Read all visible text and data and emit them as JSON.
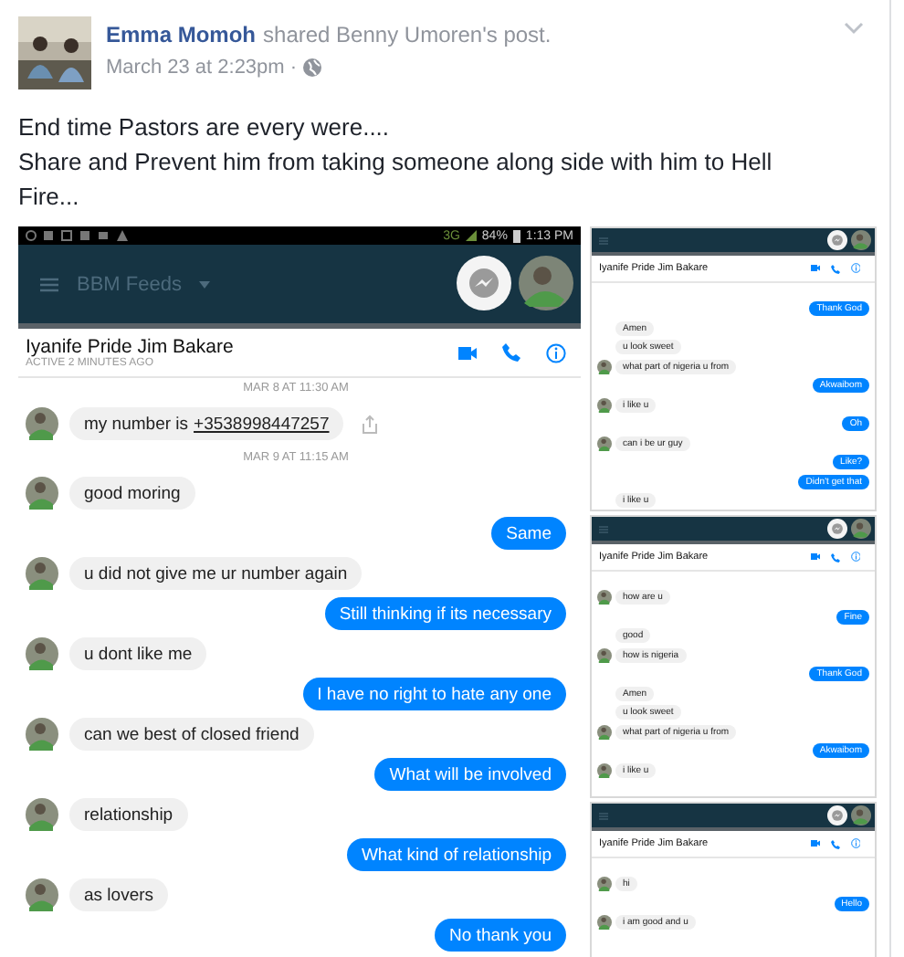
{
  "post": {
    "author": "Emma Momoh",
    "action": "shared Benny Umoren's post.",
    "time": "March 23 at 2:23pm",
    "separator": "·",
    "lines": [
      "End time Pastors are every were....",
      "Share and Prevent him from taking someone along side with him to Hell Fire..."
    ]
  },
  "screenshots": [
    {
      "kind": "main",
      "status_bar": {
        "network": "3G",
        "battery": "84%",
        "time": "1:13 PM"
      },
      "app_title": "BBM Feeds",
      "contact": "Iyanife Pride Jim Bakare",
      "presence": "ACTIVE 2 MINUTES AGO",
      "messages": [
        {
          "kind": "date",
          "text": "MAR 8 AT 11:30 AM"
        },
        {
          "kind": "incoming",
          "text": "my number is",
          "link": "+3538998447257",
          "avatar": true,
          "shared": true
        },
        {
          "kind": "date",
          "text": "MAR 9 AT 11:15 AM"
        },
        {
          "kind": "incoming",
          "text": "good moring",
          "avatar": true
        },
        {
          "kind": "outgoing",
          "text": "Same"
        },
        {
          "kind": "incoming",
          "text": "u did not give me ur number again",
          "avatar": true
        },
        {
          "kind": "outgoing",
          "text": "Still thinking if its necessary"
        },
        {
          "kind": "incoming",
          "text": "u dont like me",
          "avatar": true
        },
        {
          "kind": "outgoing",
          "text": "I have no right to hate any one"
        },
        {
          "kind": "incoming",
          "text": "can we best of closed friend",
          "avatar": true
        },
        {
          "kind": "outgoing",
          "text": "What will be involved"
        },
        {
          "kind": "incoming",
          "text": "relationship",
          "avatar": true
        },
        {
          "kind": "outgoing",
          "text": "What kind of relationship"
        },
        {
          "kind": "incoming",
          "text": "as lovers",
          "avatar": true
        },
        {
          "kind": "outgoing",
          "text": "No thank you"
        }
      ]
    },
    {
      "kind": "mini",
      "contact": "Iyanife Pride Jim Bakare",
      "messages": [
        {
          "kind": "outgoing",
          "text": "Thank God"
        },
        {
          "kind": "incoming",
          "text": "Amen",
          "avatar": false
        },
        {
          "kind": "incoming",
          "text": "u look sweet",
          "avatar": false
        },
        {
          "kind": "incoming",
          "text": "what part of nigeria u from",
          "avatar": true
        },
        {
          "kind": "outgoing",
          "text": "Akwaibom"
        },
        {
          "kind": "incoming",
          "text": "i like u",
          "avatar": true
        },
        {
          "kind": "outgoing",
          "text": "Oh"
        },
        {
          "kind": "incoming",
          "text": "can i be ur guy",
          "avatar": true
        },
        {
          "kind": "outgoing",
          "text": "Like?"
        },
        {
          "kind": "outgoing",
          "text": "Didn't get that"
        },
        {
          "kind": "incoming",
          "text": "i like u",
          "avatar": false
        }
      ]
    },
    {
      "kind": "mini",
      "contact": "Iyanife Pride Jim Bakare",
      "messages": [
        {
          "kind": "incoming",
          "text": "how are u",
          "avatar": true
        },
        {
          "kind": "outgoing",
          "text": "Fine"
        },
        {
          "kind": "incoming",
          "text": "good",
          "avatar": false
        },
        {
          "kind": "incoming",
          "text": "how is nigeria",
          "avatar": true
        },
        {
          "kind": "outgoing",
          "text": "Thank God"
        },
        {
          "kind": "incoming",
          "text": "Amen",
          "avatar": false
        },
        {
          "kind": "incoming",
          "text": "u look sweet",
          "avatar": false
        },
        {
          "kind": "incoming",
          "text": "what part of nigeria u from",
          "avatar": true
        },
        {
          "kind": "outgoing",
          "text": "Akwaibom"
        },
        {
          "kind": "incoming",
          "text": "i like u",
          "avatar": true
        }
      ]
    },
    {
      "kind": "mini",
      "contact": "Iyanife Pride Jim Bakare",
      "messages": [
        {
          "kind": "incoming",
          "text": "hi",
          "avatar": true
        },
        {
          "kind": "outgoing",
          "text": "Hello"
        },
        {
          "kind": "incoming",
          "text": "i am good and u",
          "avatar": true
        }
      ]
    }
  ]
}
